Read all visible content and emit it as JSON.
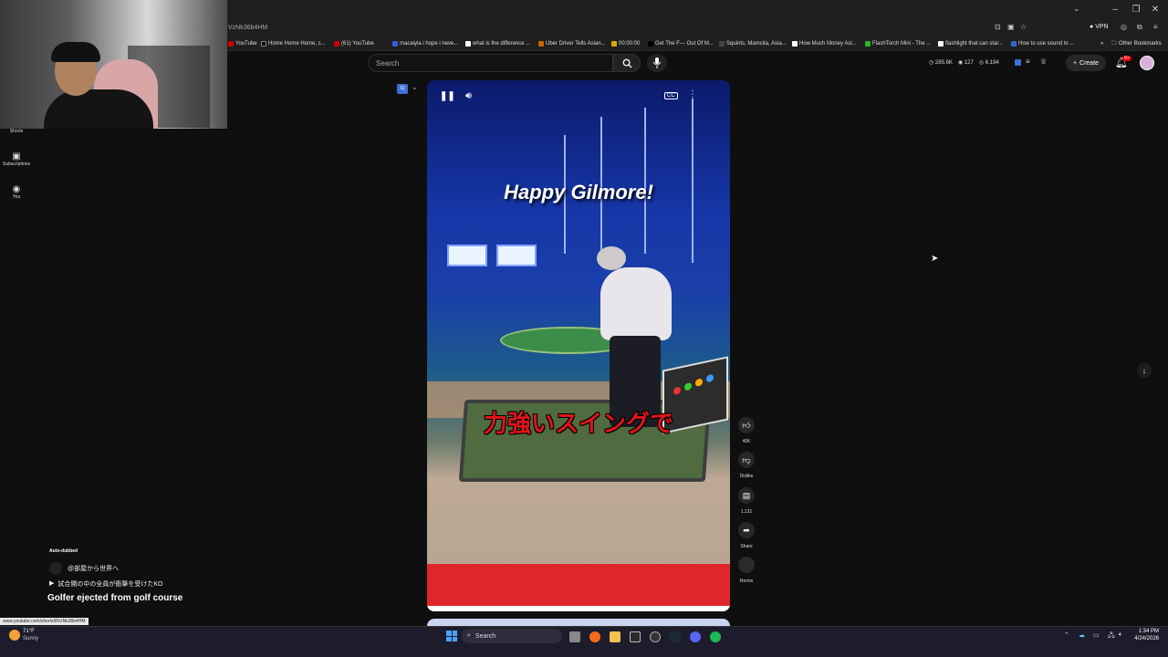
{
  "browser": {
    "url_fragment": "VzNk36b4HM",
    "vpn_label": "VPN",
    "bookmarks": [
      "YouTube",
      "Home Home Home, c...",
      "(61) YouTube",
      "macaiyla i hope i neve...",
      "what is the difference ...",
      "Uber Driver Tells Asian...",
      "00:00:00",
      "Get The F--- Out Of M...",
      "Squints, Mamcita, Asia...",
      "How Much Money Asi...",
      "FlashTorch Mini - The ...",
      "flashlight that can star...",
      "How to use sound to ...",
      "Other Bookmarks"
    ]
  },
  "yt": {
    "search_placeholder": "Search",
    "stats": [
      "285.6K",
      "127",
      "6,194"
    ],
    "create_label": "Create",
    "notif_badge": "9+"
  },
  "nav": [
    {
      "label": "Shorts",
      "icon": "shorts-icon"
    },
    {
      "label": "Subscriptions",
      "icon": "subscriptions-icon"
    },
    {
      "label": "You",
      "icon": "you-icon"
    }
  ],
  "video": {
    "overlay_title": "Happy Gilmore!",
    "overlay_subtitle": "力強いスイングで",
    "cc_label": "CC"
  },
  "actions": {
    "like_count": "40K",
    "dislike_label": "Dislike",
    "comment_count": "1,131",
    "share_label": "Share",
    "remix_label": "Remix"
  },
  "info": {
    "auto_dubbed": "Auto-dubbed",
    "channel": "@部屋から世界へ",
    "linked_video": "試合開の中の全員が衝撃を受けたKO",
    "title": "Golfer ejected from golf course",
    "status_url": "www.youtube.com/shorts/8VzNk36b4HM"
  },
  "taskbar": {
    "weather_temp": "71°F",
    "weather_desc": "Sunny",
    "search_label": "Search",
    "time": "1:34 PM",
    "date": "4/24/2026"
  },
  "colors": {
    "accent_red": "#e0141b",
    "yt_bg": "#0f0f0f"
  }
}
